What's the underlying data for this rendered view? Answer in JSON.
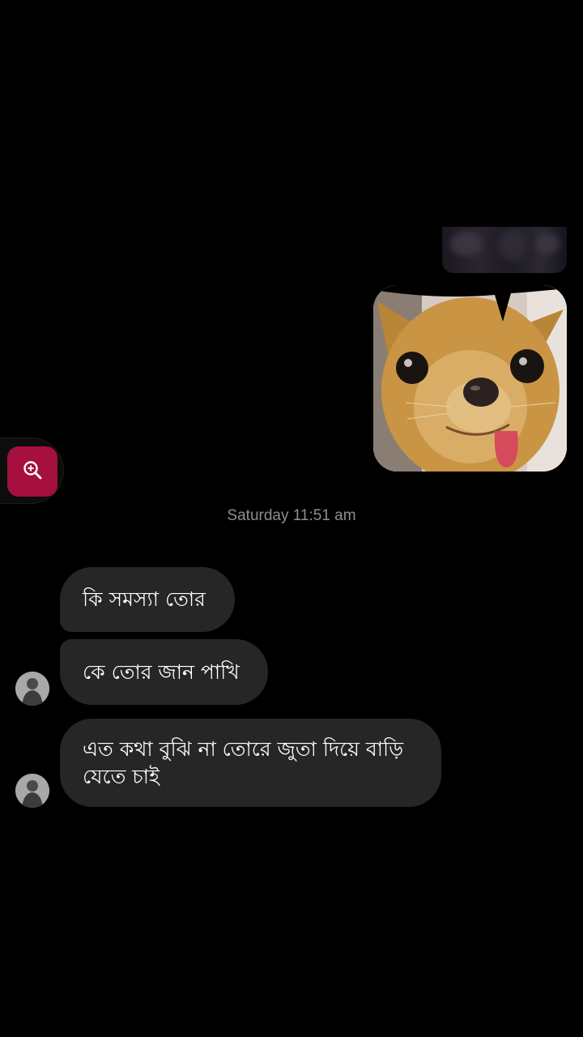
{
  "thread": {
    "timestamp": "Saturday 11:51 am",
    "messages": [
      {
        "sender": "other",
        "text": "কি সমস্যা তোর"
      },
      {
        "sender": "other",
        "text": "কে তোর জান পাখি"
      },
      {
        "sender": "other",
        "text": "এত কথা বুঝি না তোরে জুতা দিয়ে  বাড়ি যেতে চাই"
      }
    ]
  },
  "colors": {
    "background": "#000000",
    "bubble": "#262626",
    "zoom_button": "#a5103f",
    "timestamp": "#8e8e93"
  },
  "icons": {
    "zoom": "zoom-in-icon"
  }
}
